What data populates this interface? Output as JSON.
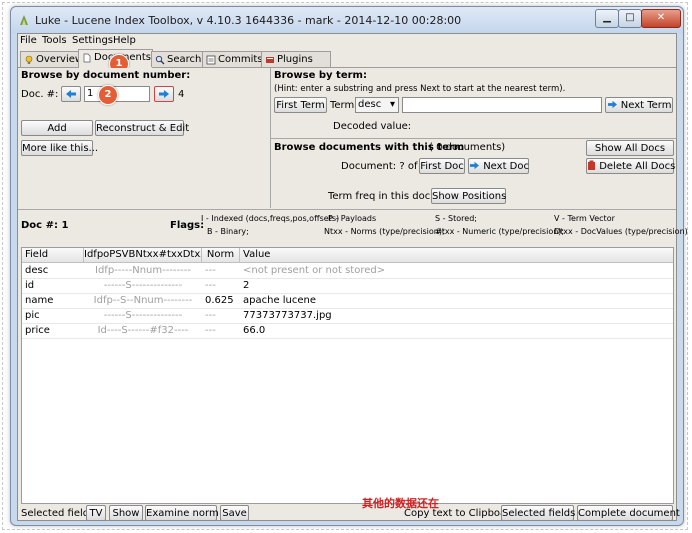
{
  "window": {
    "title": "Luke - Lucene Index Toolbox, v 4.10.3 1644336 - mark - 2014-12-10 00:28:00",
    "min_glyph": "▁",
    "max_glyph": "□",
    "close_glyph": "✕"
  },
  "menu": {
    "file": "File",
    "tools": "Tools",
    "settings": "Settings",
    "help": "Help"
  },
  "tabs": [
    {
      "label": "Overview",
      "icon": "bulb-icon"
    },
    {
      "label": "Documents",
      "icon": "document-icon",
      "active": true
    },
    {
      "label": "Search",
      "icon": "search-icon"
    },
    {
      "label": "Commits",
      "icon": "commits-icon"
    },
    {
      "label": "Plugins",
      "icon": "plugins-icon"
    }
  ],
  "badges": {
    "one": "1",
    "two": "2"
  },
  "browse_number": {
    "heading": "Browse by document number:",
    "doc_label": "Doc. #: 0",
    "doc_value": "1",
    "max_label": "4",
    "add": "Add",
    "reconstruct": "Reconstruct & Edit",
    "more_like": "More like this..."
  },
  "browse_term": {
    "heading": "Browse by term:",
    "hint": "(Hint: enter a substring and press Next to start at the nearest term).",
    "first_term": "First Term",
    "term_label": "Term:",
    "term_field": "desc",
    "term_value": "",
    "next_term": "Next Term",
    "decoded": "Decoded value:"
  },
  "browse_docs": {
    "heading": "Browse documents with this term",
    "count": "( 0  documents)",
    "doc_status": "Document: ?  of ?",
    "first_doc": "First Doc",
    "next_doc": "Next Doc",
    "show_all": "Show All Docs",
    "delete_all": "Delete All Docs",
    "term_freq": "Term freq in this doc: ?",
    "show_positions": "Show Positions"
  },
  "flags": {
    "doc_label": "Doc #: 1",
    "flags_label": "Flags:",
    "legend": [
      "I - Indexed (docs,freqs,pos,offsets)",
      "P - Payloads",
      "S - Stored;",
      "V - Term Vector",
      "B - Binary;",
      "Ntxx - Norms (type/precision);",
      "#txx - Numeric (type/precision);",
      "Dtxx - DocValues (type/precision)"
    ]
  },
  "table": {
    "columns": [
      "Field",
      "IdfpoPSVBNtxx#txxDtxx",
      "Norm",
      "Value"
    ],
    "rows": [
      {
        "field": "desc",
        "flags": "Idfp-----Nnum--------",
        "norm": "---",
        "value": "<not present or not stored>",
        "muted": true
      },
      {
        "field": "id",
        "flags": "------S--------------",
        "norm": "---",
        "value": "2",
        "muted": false
      },
      {
        "field": "name",
        "flags": "Idfp--S--Nnum--------",
        "norm": "0.625",
        "value": "apache lucene",
        "muted": false
      },
      {
        "field": "pic",
        "flags": "------S--------------",
        "norm": "---",
        "value": "77373773737.jpg",
        "muted": false
      },
      {
        "field": "price",
        "flags": "Id----S------#f32----",
        "norm": "---",
        "value": "66.0",
        "muted": false
      }
    ]
  },
  "annotation_note": "其他的数据还在",
  "bottom": {
    "selected_field": "Selected field:",
    "tv": "TV",
    "show": "Show",
    "examine_norm": "Examine norm",
    "save": "Save",
    "copy_label": "Copy text to Clipboard:",
    "selected_fields": "Selected fields",
    "complete_document": "Complete document"
  },
  "colors": {
    "badge": "#e35d36",
    "annotation_text": "#d21f1f",
    "nav_arrow": "#1f7fd0"
  }
}
